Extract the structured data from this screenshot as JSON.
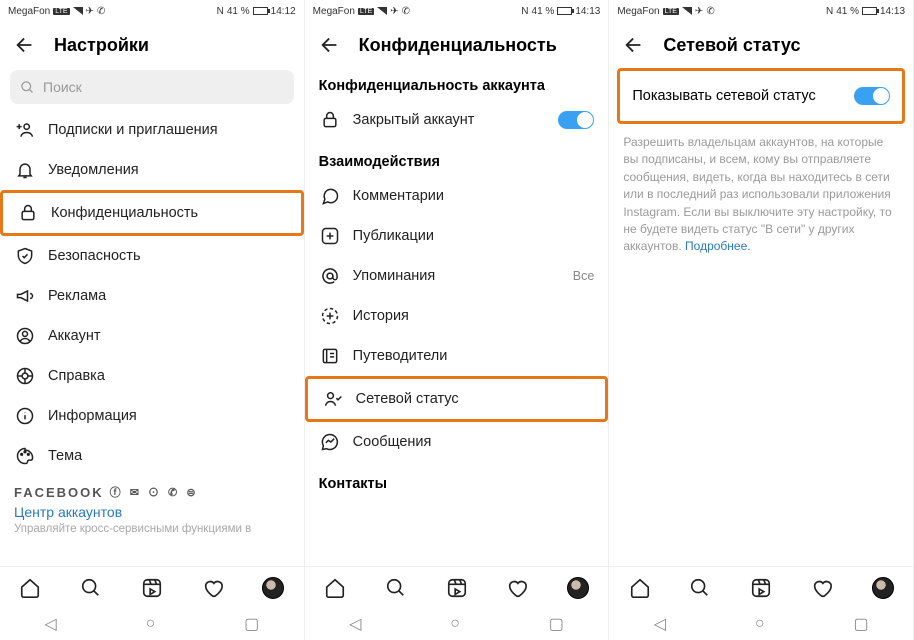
{
  "status": {
    "carrier": "MegaFon",
    "nfc": "N",
    "battery": "41 %",
    "time1": "14:12",
    "time2": "14:13",
    "time3": "14:13"
  },
  "panel1": {
    "title": "Настройки",
    "search_placeholder": "Поиск",
    "items": [
      "Подписки и приглашения",
      "Уведомления",
      "Конфиденциальность",
      "Безопасность",
      "Реклама",
      "Аккаунт",
      "Справка",
      "Информация",
      "Тема"
    ],
    "facebook": "FACEBOOK",
    "accounts_link": "Центр аккаунтов",
    "cut_text": "Управляйте кросс-сервисными функциями в"
  },
  "panel2": {
    "title": "Конфиденциальность",
    "sec1": "Конфиденциальность аккаунта",
    "private_label": "Закрытый аккаунт",
    "sec2": "Взаимодействия",
    "items": [
      "Комментарии",
      "Публикации",
      "Упоминания",
      "История",
      "Путеводители",
      "Сетевой статус",
      "Сообщения"
    ],
    "mentions_meta": "Все",
    "sec3": "Контакты"
  },
  "panel3": {
    "title": "Сетевой статус",
    "toggle_label": "Показывать сетевой статус",
    "description": "Разрешить владельцам аккаунтов, на которые вы подписаны, и всем, кому вы отправляете сообщения, видеть, когда вы находитесь в сети или в последний раз использовали приложения Instagram. Если вы выключите эту настройку, то не будете видеть статус \"В сети\" у других аккаунтов.",
    "more": "Подробнее."
  }
}
